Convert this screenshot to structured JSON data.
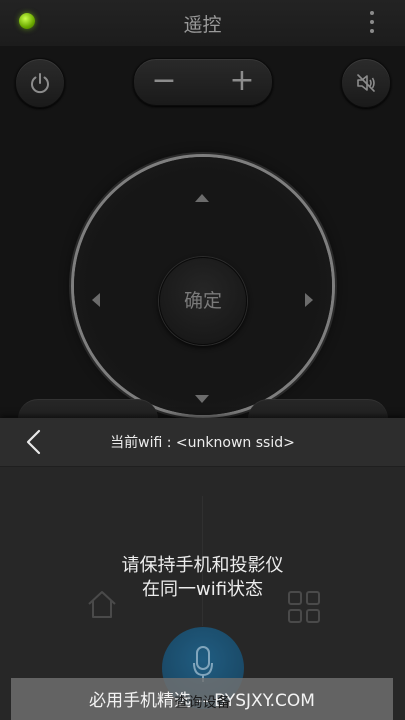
{
  "header": {
    "title": "遥控"
  },
  "remote": {
    "volume_minus": "−",
    "volume_plus": "+",
    "ok_label": "确定"
  },
  "overlay": {
    "wifi_label": "当前wifi : <unknown ssid>",
    "message_line1": "请保持手机和投影仪",
    "message_line2": "在同一wifi状态",
    "query_button": "查询设备",
    "watermark": "必用手机精选 -- BYSJXY.COM"
  },
  "colors": {
    "status_dot": "#7ac700",
    "background": "#161616",
    "overlay": "#272727",
    "voice_button": "#1b6a99"
  },
  "icons": [
    "status-dot",
    "more-icon",
    "power-icon",
    "mute-icon",
    "home-icon",
    "grid-icon",
    "microphone-icon",
    "back-icon"
  ]
}
